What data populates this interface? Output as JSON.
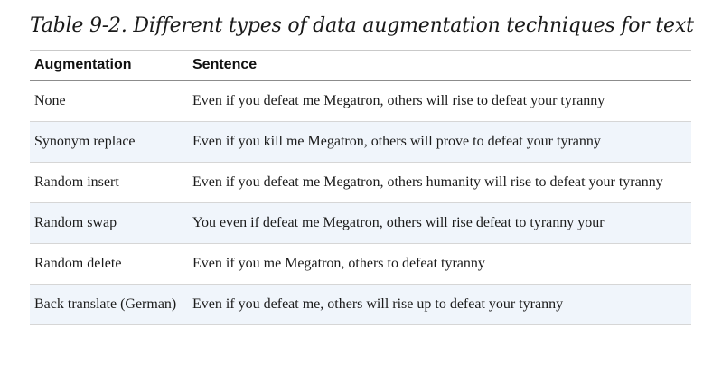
{
  "caption": "Table 9-2. Different types of data augmentation techniques for text",
  "table": {
    "headers": {
      "augmentation": "Augmentation",
      "sentence": "Sentence"
    },
    "rows": [
      {
        "augmentation": "None",
        "sentence": "Even if you defeat me Megatron, others will rise to defeat your tyranny"
      },
      {
        "augmentation": "Synonym replace",
        "sentence": "Even if you kill me Megatron, others will prove to defeat your tyranny"
      },
      {
        "augmentation": "Random insert",
        "sentence": "Even if you defeat me Megatron, others humanity will rise to defeat your tyranny"
      },
      {
        "augmentation": "Random swap",
        "sentence": "You even if defeat me Megatron, others will rise defeat to tyranny your"
      },
      {
        "augmentation": "Random delete",
        "sentence": "Even if you me Megatron, others to defeat tyranny"
      },
      {
        "augmentation": "Back translate (German)",
        "sentence": "Even if you defeat me, others will rise up to defeat your tyranny"
      }
    ]
  },
  "colors": {
    "stripe": "#f0f5fb",
    "header_rule": "#8c8c8c",
    "row_rule": "#d6d6d6"
  }
}
